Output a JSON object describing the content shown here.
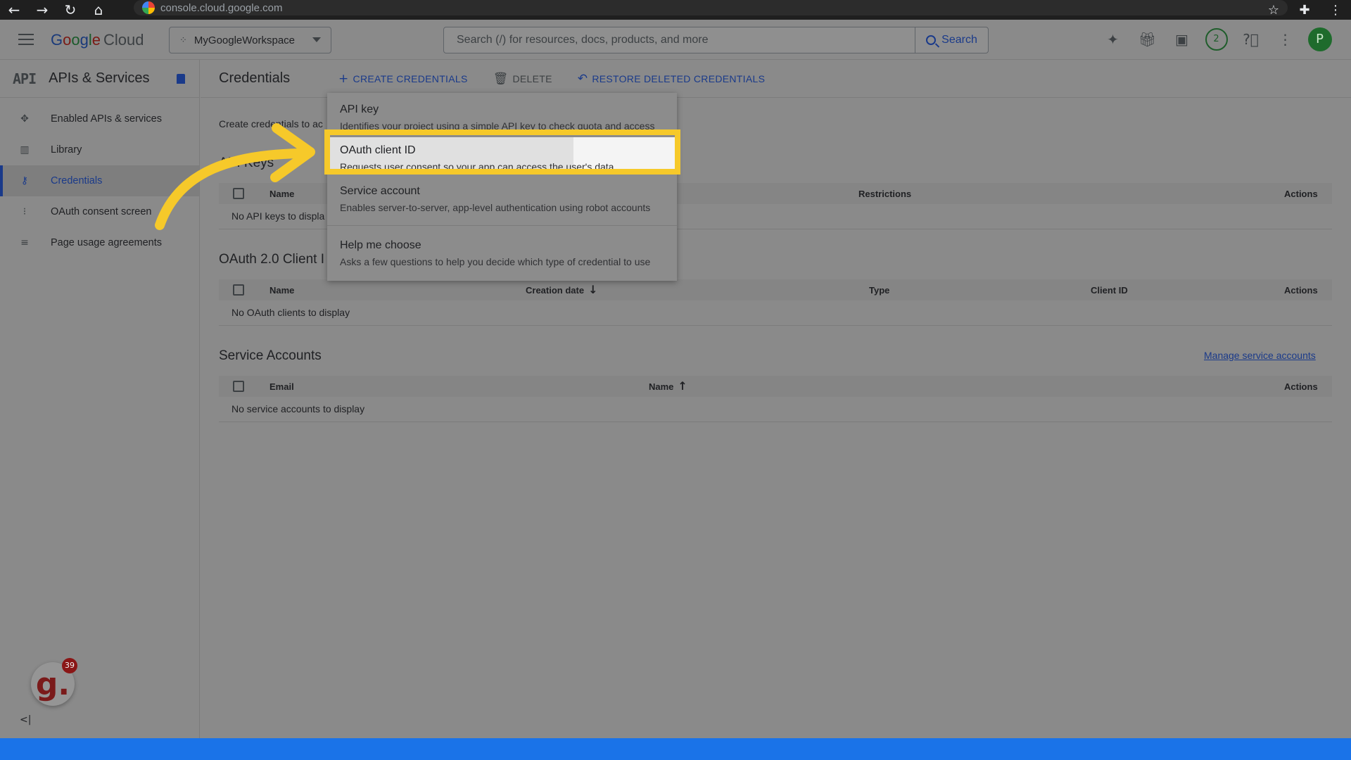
{
  "browser": {
    "url": "console.cloud.google.com",
    "nav_icons": [
      "back-icon",
      "forward-icon",
      "reload-icon",
      "home-icon"
    ],
    "right_icons": [
      "star-icon",
      "extensions-icon",
      "menu-icon"
    ]
  },
  "header": {
    "brand_google": "Google",
    "brand_cloud": "Cloud",
    "project": "MyGoogleWorkspace",
    "search_placeholder": "Search (/) for resources, docs, products, and more",
    "search_button": "Search",
    "notifications_count": "2",
    "avatar_initial": "P",
    "icons": [
      "gemini-icon",
      "gift-icon",
      "cloud-shell-icon",
      "notifications-icon",
      "help-icon",
      "more-icon",
      "avatar"
    ]
  },
  "sidebar": {
    "api_logo": "API",
    "title": "APIs & Services",
    "items": [
      {
        "label": "Enabled APIs & services",
        "icon": "dashboard-icon",
        "active": false
      },
      {
        "label": "Library",
        "icon": "library-icon",
        "active": false
      },
      {
        "label": "Credentials",
        "icon": "key-icon",
        "active": true
      },
      {
        "label": "OAuth consent screen",
        "icon": "consent-icon",
        "active": false
      },
      {
        "label": "Page usage agreements",
        "icon": "agreements-icon",
        "active": false
      }
    ],
    "badge_letter": "g.",
    "badge_count": "39",
    "collapse_label": "<|"
  },
  "toolbar": {
    "title": "Credentials",
    "create": "CREATE CREDENTIALS",
    "delete": "DELETE",
    "restore": "RESTORE DELETED CREDENTIALS"
  },
  "main": {
    "intro": "Create credentials to ac",
    "api_keys": {
      "title": "API Keys",
      "columns": [
        "Name",
        "Restrictions",
        "Actions"
      ],
      "empty": "No API keys to displa"
    },
    "oauth": {
      "title": "OAuth 2.0 Client I",
      "columns": [
        "Name",
        "Creation date",
        "Type",
        "Client ID",
        "Actions"
      ],
      "empty": "No OAuth clients to display"
    },
    "service_accounts": {
      "title": "Service Accounts",
      "manage_link": "Manage service accounts",
      "columns": [
        "Email",
        "Name",
        "Actions"
      ],
      "empty": "No service accounts to display"
    }
  },
  "menu": {
    "items": [
      {
        "title": "API key",
        "desc": "Identifies your project using a simple API key to check quota and access"
      },
      {
        "title": "OAuth client ID",
        "desc": "Requests user consent so your app can access the user's data"
      },
      {
        "title": "Service account",
        "desc": "Enables server-to-server, app-level authentication using robot accounts"
      },
      {
        "title": "Help me choose",
        "desc": "Asks a few questions to help you decide which type of credential to use"
      }
    ]
  },
  "colors": {
    "highlight": "#f6c92a",
    "accent": "#1a73e8",
    "arrow": "#f6c92a"
  }
}
